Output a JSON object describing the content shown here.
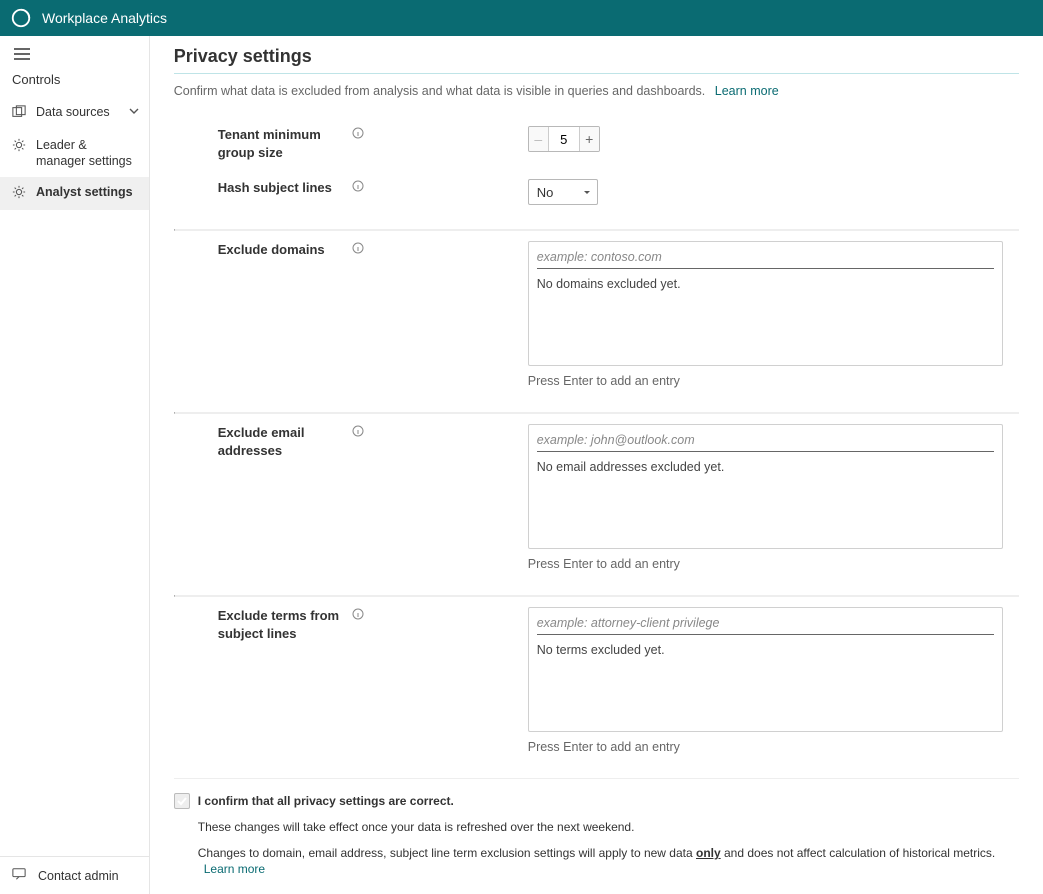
{
  "header": {
    "app_title": "Workplace Analytics"
  },
  "sidebar": {
    "heading": "Controls",
    "items": [
      {
        "label": "Data sources",
        "icon": "data-sources-icon",
        "has_caret": true,
        "selected": false
      },
      {
        "label": "Leader & manager settings",
        "icon": "gear-icon",
        "has_caret": false,
        "selected": false
      },
      {
        "label": "Analyst settings",
        "icon": "gear-icon",
        "has_caret": false,
        "selected": true
      }
    ],
    "footer": {
      "label": "Contact admin"
    }
  },
  "page": {
    "title": "Privacy settings",
    "subtitle": "Confirm what data is excluded from analysis and what data is visible in queries and dashboards.",
    "learn_more": "Learn more"
  },
  "settings": {
    "min_group": {
      "label": "Tenant minimum group size",
      "value": "5"
    },
    "hash_subject": {
      "label": "Hash subject lines",
      "value": "No"
    },
    "exclude_domains": {
      "label": "Exclude domains",
      "placeholder": "example: contoso.com",
      "empty_text": "No domains excluded yet.",
      "hint": "Press Enter to add an entry"
    },
    "exclude_emails": {
      "label": "Exclude email addresses",
      "placeholder": "example: john@outlook.com",
      "empty_text": "No email addresses excluded yet.",
      "hint": "Press Enter to add an entry"
    },
    "exclude_terms": {
      "label": "Exclude terms from subject lines",
      "placeholder": "example: attorney-client privilege",
      "empty_text": "No terms excluded yet.",
      "hint": "Press Enter to add an entry"
    }
  },
  "confirm": {
    "checkbox_label": "I confirm that all privacy settings are correct.",
    "note1": "These changes will take effect once your data is refreshed over the next weekend.",
    "note2_a": "Changes to domain, email address, subject line term exclusion settings will apply to new data ",
    "note2_only": "only",
    "note2_b": " and does not affect calculation of historical metrics.",
    "learn_more": "Learn more"
  }
}
